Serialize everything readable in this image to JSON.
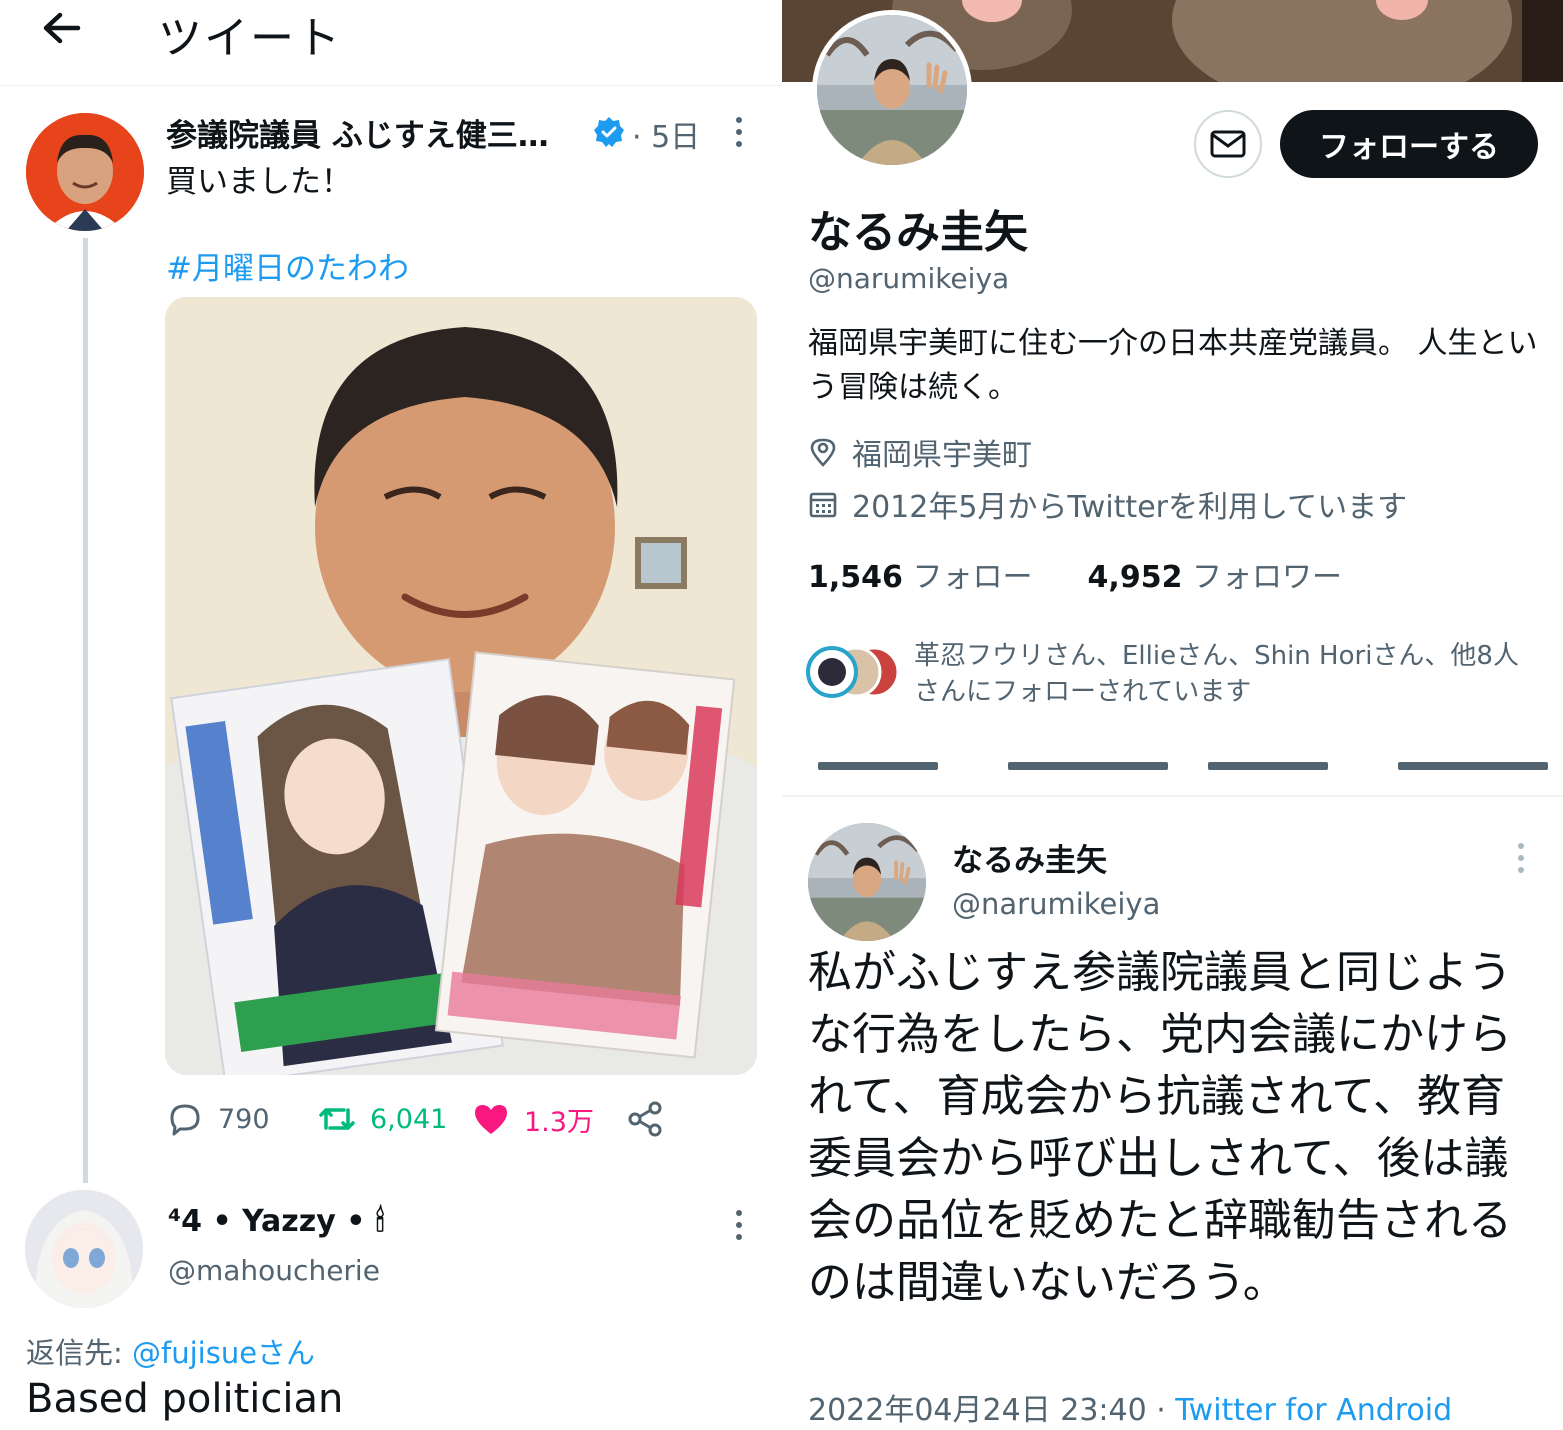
{
  "left": {
    "topbar": {
      "title": "ツイート"
    },
    "tweet": {
      "author": "参議院議員 ふじすえ健三…",
      "time": "· 5日",
      "text": "買いました！",
      "hashtag": "#月曜日のたわわ",
      "actions": {
        "replies": "790",
        "retweets": "6,041",
        "likes": "1.3万"
      }
    },
    "reply": {
      "name": "⁴4 • Yazzy • 🕯",
      "handle": "@mahoucherie",
      "reply_to_prefix": "返信先: ",
      "reply_to_mention": "@fujisueさん",
      "text": "Based politician"
    }
  },
  "profile": {
    "follow_label": "フォローする",
    "name": "なるみ圭矢",
    "handle": "@narumikeiya",
    "bio": "福岡県宇美町に住む一介の日本共産党議員。 人生という冒険は続く。",
    "location": "福岡県宇美町",
    "joined": "2012年5月からTwitterを利用しています",
    "following_count": "1,546",
    "following_label": " フォロー",
    "followers_count": "4,952",
    "followers_label": " フォロワー",
    "followed_by": "革忍フウリさん、Ellieさん、Shin Horiさん、他8人さんにフォローされています"
  },
  "narumi_tweet": {
    "name": "なるみ圭矢",
    "handle": "@narumikeiya",
    "text": "私がふじすえ参議院議員と同じような行為をしたら、党内会議にかけられて、育成会から抗議されて、教育委員会から呼び出しされて、後は議会の品位を貶めたと辞職勧告されるのは間違いないだろう。",
    "timestamp": "2022年04月24日 23:40 · ",
    "client": "Twitter for Android"
  },
  "colors": {
    "accent": "#1d9bf0",
    "retweet": "#00ba7c",
    "like": "#f91880",
    "muted": "#536471",
    "text": "#0f1419"
  }
}
